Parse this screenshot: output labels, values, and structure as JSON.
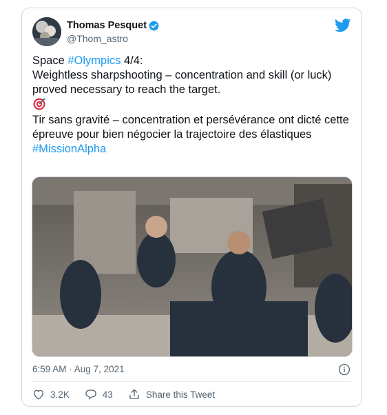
{
  "author": {
    "name": "Thomas Pesquet",
    "handle": "@Thom_astro"
  },
  "tweet": {
    "line1_prefix": "Space ",
    "line1_hashtag": "#Olympics",
    "line1_suffix": " 4/4:",
    "line2": "Weightless sharpshooting – concentration and skill (or luck) proved necessary to reach the target.",
    "emoji_name": "direct-hit",
    "line3": "Tir sans gravité – concentration et persévérance ont dicté cette épreuve pour bien négocier la trajectoire des élastiques",
    "hashtag2": "#MissionAlpha"
  },
  "meta": {
    "timestamp": "6:59 AM · Aug 7, 2021"
  },
  "actions": {
    "likes": "3.2K",
    "replies": "43",
    "share_label": "Share this Tweet"
  },
  "icons": {
    "verified": "verified-badge-icon",
    "twitter": "twitter-bird-icon",
    "info": "info-icon",
    "like": "heart-icon",
    "reply": "reply-icon",
    "share": "share-icon"
  },
  "colors": {
    "accent": "#1d9bf0",
    "text": "#0f1419",
    "secondary": "#536471",
    "border": "#cfd9de"
  }
}
